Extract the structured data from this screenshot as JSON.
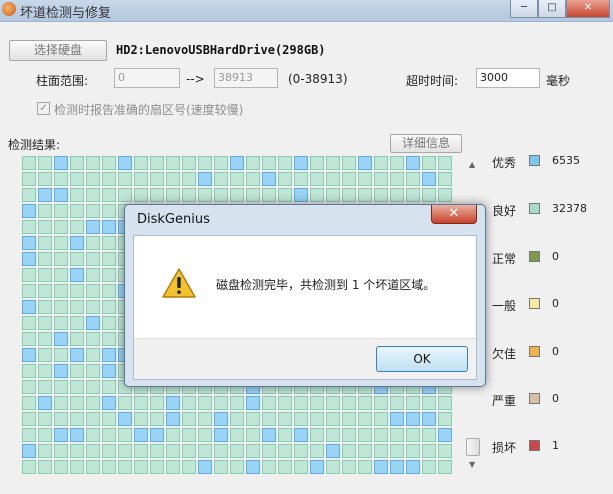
{
  "window": {
    "title": "坏道检测与修复",
    "close_glyph": "✕"
  },
  "toolbar": {
    "select_disk_label": "选择硬盘"
  },
  "disk": {
    "name": "HD2:LenovoUSBHardDrive(298GB)"
  },
  "cylinder_range": {
    "label": "柱面范围:",
    "from": "0",
    "arrow": "-->",
    "to": "38913",
    "hint": "(0-38913)"
  },
  "timeout": {
    "label": "超时时间:",
    "value": "3000",
    "unit": "毫秒"
  },
  "options": {
    "check_glyph": "✓",
    "report_sector_label": "检测时报告准确的扇区号(速度较慢)"
  },
  "results": {
    "label": "检测结果:",
    "detail_button": "详细信息"
  },
  "legend": [
    {
      "name": "优秀",
      "color": "#7cc8f0",
      "count": "6535"
    },
    {
      "name": "良好",
      "color": "#a8dcc8",
      "count": "32378"
    },
    {
      "name": "正常",
      "color": "#7f9a4c",
      "count": "0"
    },
    {
      "name": "一般",
      "color": "#f7e9a0",
      "count": "0"
    },
    {
      "name": "欠佳",
      "color": "#efb24c",
      "count": "0"
    },
    {
      "name": "严重",
      "color": "#d9bfa6",
      "count": "0"
    },
    {
      "name": "损坏",
      "color": "#c94a4a",
      "count": "1"
    }
  ],
  "dialog": {
    "title": "DiskGenius",
    "close_glyph": "✕",
    "message": "磁盘检测完毕，共检测到 1 个坏道区域。",
    "ok_label": "OK"
  }
}
